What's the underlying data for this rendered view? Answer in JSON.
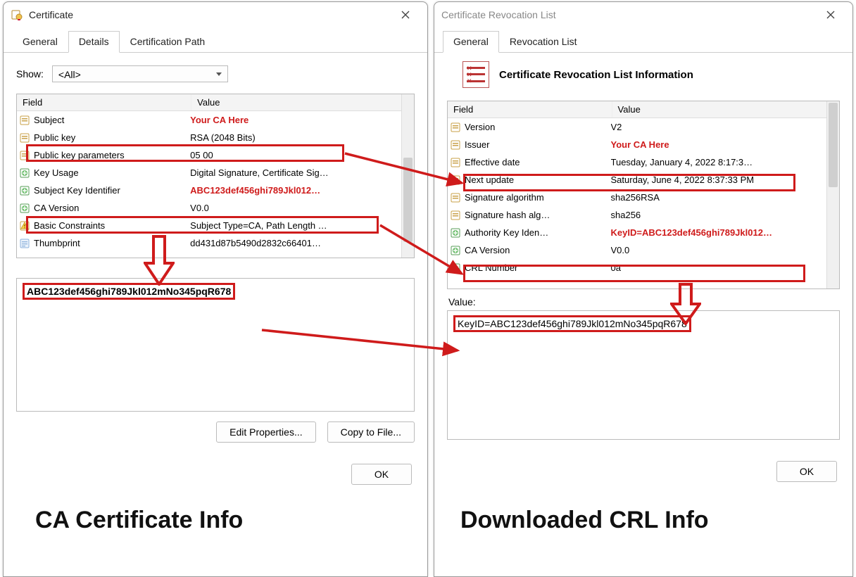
{
  "cert_window": {
    "title": "Certificate",
    "tabs": {
      "general": "General",
      "details": "Details",
      "certpath": "Certification Path"
    },
    "show_label": "Show:",
    "show_value": "<All>",
    "columns": {
      "field": "Field",
      "value": "Value"
    },
    "rows": [
      {
        "field": "Subject",
        "value": "Your CA Here",
        "icon": "cert",
        "hl": "both"
      },
      {
        "field": "Public key",
        "value": "RSA (2048 Bits)",
        "icon": "cert"
      },
      {
        "field": "Public key parameters",
        "value": "05 00",
        "icon": "cert"
      },
      {
        "field": "Key Usage",
        "value": "Digital Signature, Certificate Sig…",
        "icon": "ext"
      },
      {
        "field": "Subject Key Identifier",
        "value": "ABC123def456ghi789Jkl012…",
        "icon": "extb",
        "hl": "row"
      },
      {
        "field": "CA Version",
        "value": "V0.0",
        "icon": "ext"
      },
      {
        "field": "Basic Constraints",
        "value": "Subject Type=CA, Path Length …",
        "icon": "warn"
      },
      {
        "field": "Thumbprint",
        "value": "dd431d87b5490d2832c66401…",
        "icon": "prop"
      }
    ],
    "detail_value": "ABC123def456ghi789Jkl012mNo345pqR678",
    "buttons": {
      "edit": "Edit Properties...",
      "copy": "Copy to File..."
    },
    "ok": "OK"
  },
  "crl_window": {
    "title": "Certificate Revocation List",
    "tabs": {
      "general": "General",
      "revlist": "Revocation List"
    },
    "heading": "Certificate Revocation List Information",
    "columns": {
      "field": "Field",
      "value": "Value"
    },
    "rows": [
      {
        "field": "Version",
        "value": "V2",
        "icon": "cert"
      },
      {
        "field": "Issuer",
        "value": "Your CA Here",
        "icon": "cert",
        "hl": "both"
      },
      {
        "field": "Effective date",
        "value": "Tuesday, January 4, 2022 8:17:3…",
        "icon": "cert"
      },
      {
        "field": "Next update",
        "value": "Saturday, June 4, 2022 8:37:33 PM",
        "icon": "cert"
      },
      {
        "field": "Signature algorithm",
        "value": "sha256RSA",
        "icon": "cert"
      },
      {
        "field": "Signature hash alg…",
        "value": "sha256",
        "icon": "cert"
      },
      {
        "field": "Authority Key Iden…",
        "value": "KeyID=ABC123def456ghi789Jkl012…",
        "icon": "ext",
        "hl": "row"
      },
      {
        "field": "CA Version",
        "value": "V0.0",
        "icon": "ext"
      },
      {
        "field": "CRL Number",
        "value": "0a",
        "icon": "ext"
      }
    ],
    "value_label": "Value:",
    "detail_value": "KeyID=ABC123def456ghi789Jkl012mNo345pqR678",
    "ok": "OK"
  },
  "labels": {
    "left": "CA Certificate Info",
    "right": "Downloaded CRL Info"
  },
  "colors": {
    "red": "#cf1b1b"
  }
}
